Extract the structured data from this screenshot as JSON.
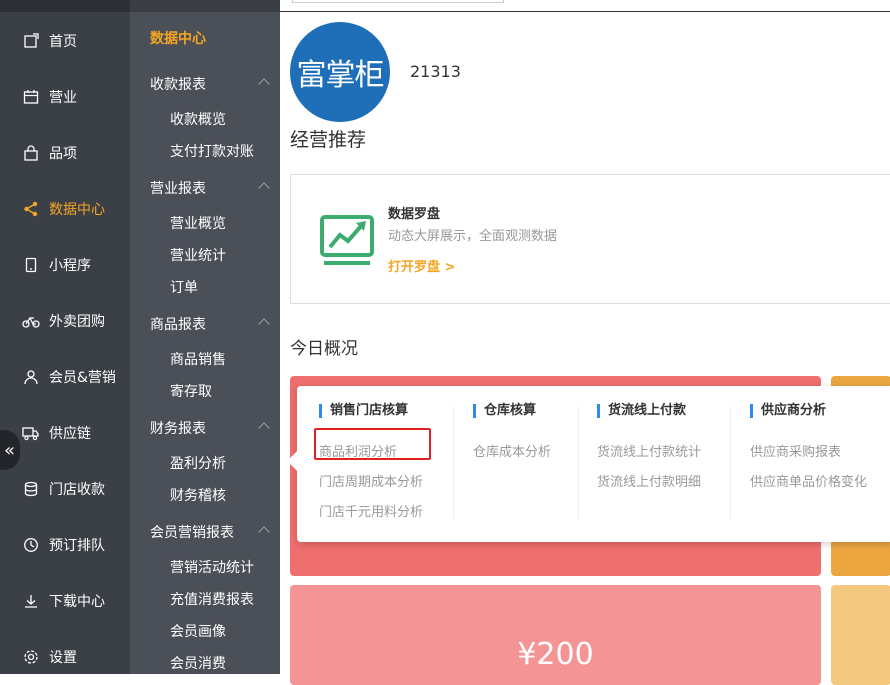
{
  "nav": [
    {
      "label": "首页",
      "icon": "home-icon"
    },
    {
      "label": "营业",
      "icon": "calendar-icon"
    },
    {
      "label": "品项",
      "icon": "bag-icon"
    },
    {
      "label": "数据中心",
      "icon": "share-icon",
      "active": true
    },
    {
      "label": "小程序",
      "icon": "phone-icon"
    },
    {
      "label": "外卖团购",
      "icon": "bike-icon"
    },
    {
      "label": "会员&营销",
      "icon": "user-icon"
    },
    {
      "label": "供应链",
      "icon": "truck-icon"
    },
    {
      "label": "门店收款",
      "icon": "database-icon"
    },
    {
      "label": "预订排队",
      "icon": "clock-icon"
    },
    {
      "label": "下载中心",
      "icon": "download-icon"
    },
    {
      "label": "设置",
      "icon": "gear-icon"
    }
  ],
  "collapse_glyph": "«",
  "subnav": {
    "title": "数据中心",
    "groups": [
      {
        "label": "收款报表",
        "items": [
          "收款概览",
          "支付打款对账"
        ]
      },
      {
        "label": "营业报表",
        "items": [
          "营业概览",
          "营业统计",
          "订单"
        ]
      },
      {
        "label": "商品报表",
        "items": [
          "商品销售",
          "寄存取"
        ]
      },
      {
        "label": "财务报表",
        "items": [
          "盈利分析",
          "财务稽核"
        ]
      },
      {
        "label": "会员营销报表",
        "items": [
          "营销活动统计",
          "充值消费报表",
          "会员画像",
          "会员消费"
        ]
      }
    ],
    "submenu_arrow": ">"
  },
  "shop": {
    "logo_text": "富掌柜",
    "id": "21313"
  },
  "recommend": {
    "heading": "经营推荐",
    "card": {
      "title": "数据罗盘",
      "desc": "动态大屏展示，全面观测数据",
      "link": "打开罗盘 >"
    }
  },
  "today": {
    "heading": "今日概况",
    "amount": "¥200"
  },
  "popup": {
    "columns": [
      {
        "title": "销售门店核算",
        "items": [
          "商品利润分析",
          "门店周期成本分析",
          "门店千元用料分析"
        ]
      },
      {
        "title": "仓库核算",
        "items": [
          "仓库成本分析"
        ]
      },
      {
        "title": "货流线上付款",
        "items": [
          "货流线上付款统计",
          "货流线上付款明细"
        ]
      },
      {
        "title": "供应商分析",
        "items": [
          "供应商采购报表",
          "供应商单品价格变化"
        ]
      }
    ]
  },
  "colors": {
    "accent": "#f5a623",
    "sidebar": "#3b3f46",
    "subnav": "#4b4f57",
    "tile_red": "#ef6f6f",
    "tile_orange": "#eba640",
    "highlight": "#e02020",
    "blue_bar": "#2e8be8"
  }
}
